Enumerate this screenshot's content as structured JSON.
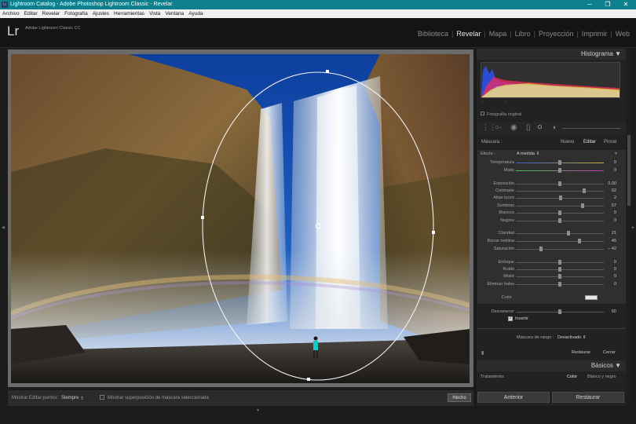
{
  "window": {
    "title": "Lightroom Catalog - Adobe Photoshop Lightroom Classic - Revelar",
    "logo": "Lr"
  },
  "menu": [
    "Archivo",
    "Editar",
    "Revelar",
    "Fotografía",
    "Ajustes",
    "Herramientas",
    "Vista",
    "Ventana",
    "Ayuda"
  ],
  "identity": {
    "logo": "Lr",
    "app_name": "Adobe Lightroom Classic CC"
  },
  "modules": [
    "Biblioteca",
    "Revelar",
    "Mapa",
    "Libro",
    "Proyección",
    "Imprimir",
    "Web"
  ],
  "active_module": "Revelar",
  "histogram": {
    "title": "Histograma",
    "original_photo": "Fotografía original"
  },
  "mask": {
    "label": "Máscara :",
    "new": "Nuevo",
    "edit": "Editar",
    "brush": "Pincel"
  },
  "effect": {
    "label": "Efecto :",
    "value": "A medida"
  },
  "sliders": [
    {
      "label": "Temperatura",
      "value": "0",
      "pos": 0.5
    },
    {
      "label": "Matiz",
      "value": "0",
      "pos": 0.5
    },
    {
      "label": "Exposición",
      "value": "0,00",
      "pos": 0.5
    },
    {
      "label": "Contraste",
      "value": "62",
      "pos": 0.78
    },
    {
      "label": "Altas luces",
      "value": "2",
      "pos": 0.51
    },
    {
      "label": "Sombras",
      "value": "57",
      "pos": 0.76
    },
    {
      "label": "Blancos",
      "value": "0",
      "pos": 0.5
    },
    {
      "label": "Negros",
      "value": "0",
      "pos": 0.5
    },
    {
      "label": "Claridad",
      "value": "21",
      "pos": 0.6
    },
    {
      "label": "Borrar neblina",
      "value": "45",
      "pos": 0.72
    },
    {
      "label": "Saturación",
      "value": "− 42",
      "pos": 0.29
    },
    {
      "label": "Enfoque",
      "value": "0",
      "pos": 0.5
    },
    {
      "label": "Ruido",
      "value": "0",
      "pos": 0.5
    },
    {
      "label": "Moiré",
      "value": "0",
      "pos": 0.5
    },
    {
      "label": "Eliminar halos",
      "value": "0",
      "pos": 0.5
    }
  ],
  "color_label": "Color",
  "feather": {
    "label": "Desvanecer",
    "value": "50",
    "pos": 0.5
  },
  "invert": {
    "label": "Invertir",
    "checked": true
  },
  "range_mask": {
    "label": "Máscara de rango :",
    "value": "Desactivado"
  },
  "panel_actions": {
    "reset": "Restaurar",
    "close": "Cerrar"
  },
  "basic": {
    "title": "Básicos",
    "treatment": "Tratamiento:",
    "color": "Color",
    "bw": "Blanco y negro"
  },
  "toolbar": {
    "show_edit_points": "Mostrar Editar puntos:",
    "show_value": "Siempre",
    "overlay": "Mostrar superposición de máscara seleccionada",
    "done": "Hecho"
  },
  "bottom_buttons": {
    "previous": "Anterior",
    "reset": "Restaurar"
  },
  "colors": {
    "titlebar": "#0e7f8d",
    "panel": "#2f2f2f",
    "background": "#1b1b1b"
  }
}
